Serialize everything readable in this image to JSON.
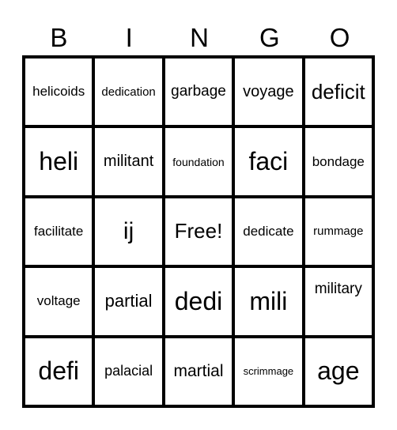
{
  "header": [
    "B",
    "I",
    "N",
    "G",
    "O"
  ],
  "cells": [
    {
      "text": "helicoids",
      "size": 17
    },
    {
      "text": "dedication",
      "size": 15
    },
    {
      "text": "garbage",
      "size": 19
    },
    {
      "text": "voyage",
      "size": 20
    },
    {
      "text": "deficit",
      "size": 26
    },
    {
      "text": "heli",
      "size": 32
    },
    {
      "text": "militant",
      "size": 20
    },
    {
      "text": "foundation",
      "size": 14
    },
    {
      "text": "faci",
      "size": 32
    },
    {
      "text": "bondage",
      "size": 17
    },
    {
      "text": "facilitate",
      "size": 17
    },
    {
      "text": "ij",
      "size": 30
    },
    {
      "text": "Free!",
      "size": 26
    },
    {
      "text": "dedicate",
      "size": 17
    },
    {
      "text": "rummage",
      "size": 15
    },
    {
      "text": "voltage",
      "size": 17
    },
    {
      "text": "partial",
      "size": 22
    },
    {
      "text": "dedi",
      "size": 32
    },
    {
      "text": "mili",
      "size": 32
    },
    {
      "text": "military",
      "size": 19,
      "align": "top"
    },
    {
      "text": "defi",
      "size": 32
    },
    {
      "text": "palacial",
      "size": 18
    },
    {
      "text": "martial",
      "size": 21
    },
    {
      "text": "scrimmage",
      "size": 13
    },
    {
      "text": "age",
      "size": 32
    }
  ]
}
